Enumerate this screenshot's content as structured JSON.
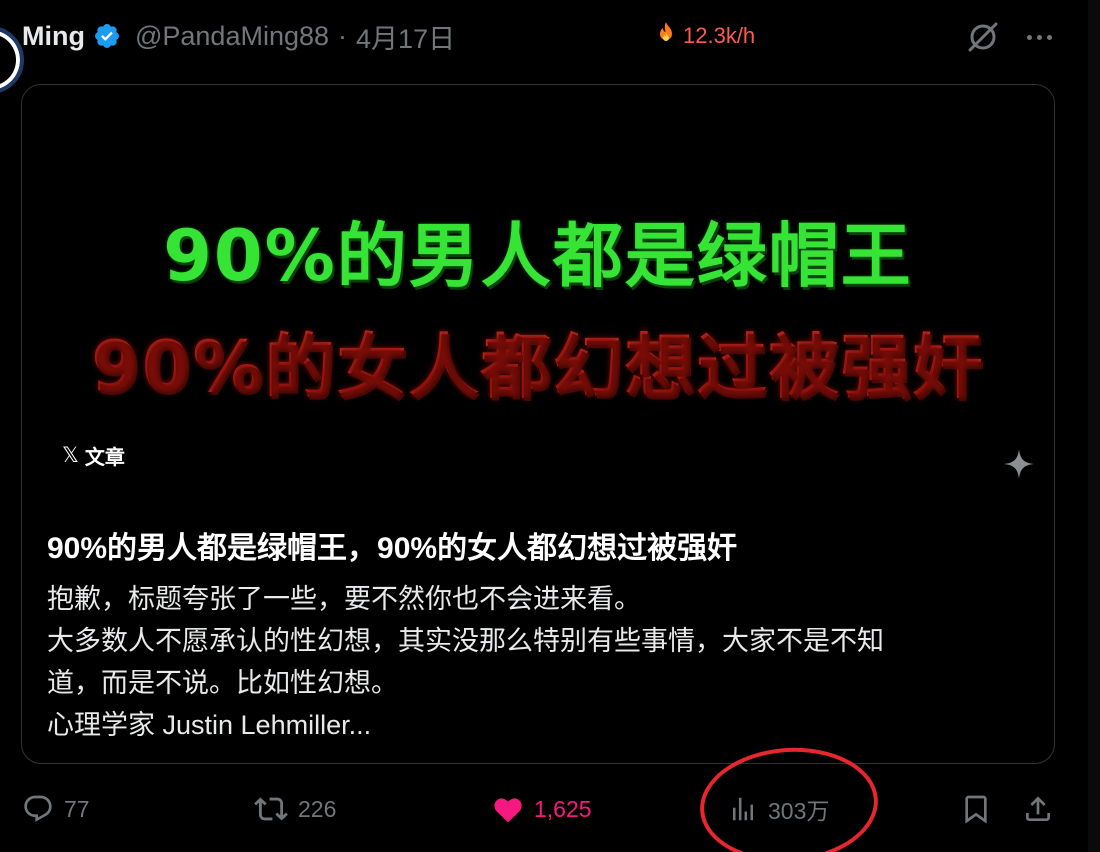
{
  "header": {
    "author_name": "Ming",
    "handle": "@PandaMing88",
    "separator": "·",
    "date": "4月17日",
    "trend_rate": "12.3k/h"
  },
  "card": {
    "banner_line_1": "90%的男人都是绿帽王",
    "banner_line_2": "90%的女人都幻想过被强奸",
    "badge_mark": "𝕏",
    "badge_label": "文章",
    "title": "90%的男人都是绿帽王，90%的女人都幻想过被强奸",
    "body_lines": [
      "抱歉，标题夸张了一些，要不然你也不会进来看。",
      "大多数人不愿承认的性幻想，其实没那么特别有些事情，大家不是不知",
      "道，而是不说。比如性幻想。",
      "心理学家 Justin Lehmiller..."
    ]
  },
  "actions": {
    "reply_count": "77",
    "repost_count": "226",
    "like_count": "1,625",
    "views_count": "303万"
  },
  "colors": {
    "background": "#000000",
    "text_primary": "#e7e9ea",
    "text_secondary": "#71767b",
    "verified_blue": "#1d9bf0",
    "like_pink": "#f91880",
    "banner_green": "#36e436",
    "banner_red": "#e0251e",
    "trend_red": "#ff5a4e",
    "annotation_red": "#e8262e"
  },
  "icons": {
    "verified": "verified-badge-icon",
    "trend": "fire-icon",
    "grok": "grok-icon",
    "more": "more-icon",
    "sparkle": "sparkle-icon",
    "reply": "reply-icon",
    "repost": "repost-icon",
    "like": "heart-icon",
    "views": "views-icon",
    "bookmark": "bookmark-icon",
    "share": "share-icon"
  }
}
